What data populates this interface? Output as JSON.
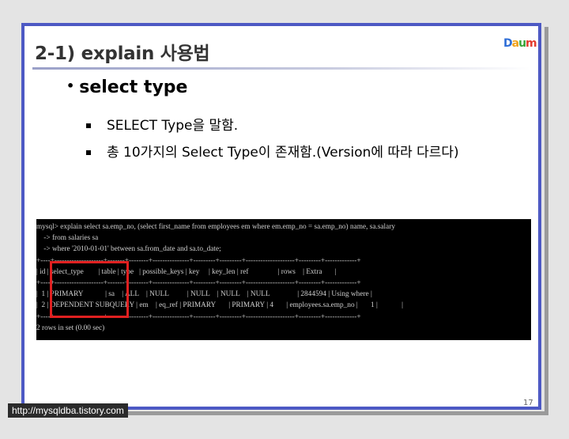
{
  "slide": {
    "title": "2-1) explain 사용법",
    "logo": {
      "part1": "D",
      "part2": "a",
      "part3": "u",
      "part4": "m"
    },
    "heading": "select type",
    "bullets": [
      "SELECT Type을 말함.",
      "총 10가지의 Select Type이 존재함.(Version에 따라 다르다)"
    ],
    "page_number": "17"
  },
  "console": {
    "lines": [
      "mysql> explain select sa.emp_no, (select first_name from employees em where em.emp_no = sa.emp_no) name, sa.salary",
      "    -> from salaries sa",
      "    -> where '2010-01-01' between sa.from_date and sa.to_date;",
      "+----+--------------------+-------+--------+---------------+---------+---------+--------------------+---------+-------------+",
      "| id | select_type        | table | type   | possible_keys | key     | key_len | ref                | rows    | Extra       |",
      "+----+--------------------+-------+--------+---------------+---------+---------+--------------------+---------+-------------+",
      "|  1 | PRIMARY            | sa    | ALL    | NULL          | NULL    | NULL    | NULL               | 2844594 | Using where |",
      "|  2 | DEPENDENT SUBQUERY | em    | eq_ref | PRIMARY       | PRIMARY | 4       | employees.sa.emp_no |       1 |             |",
      "+----+--------------------+-------+--------+---------------+---------+---------+--------------------+---------+-------------+",
      "2 rows in set (0.00 sec)"
    ],
    "highlight_color": "#e02020"
  },
  "watermark": "http://mysqldba.tistory.com",
  "colors": {
    "slide_border": "#4d59c4",
    "background": "#e4e4e4",
    "console_bg": "#000000"
  }
}
